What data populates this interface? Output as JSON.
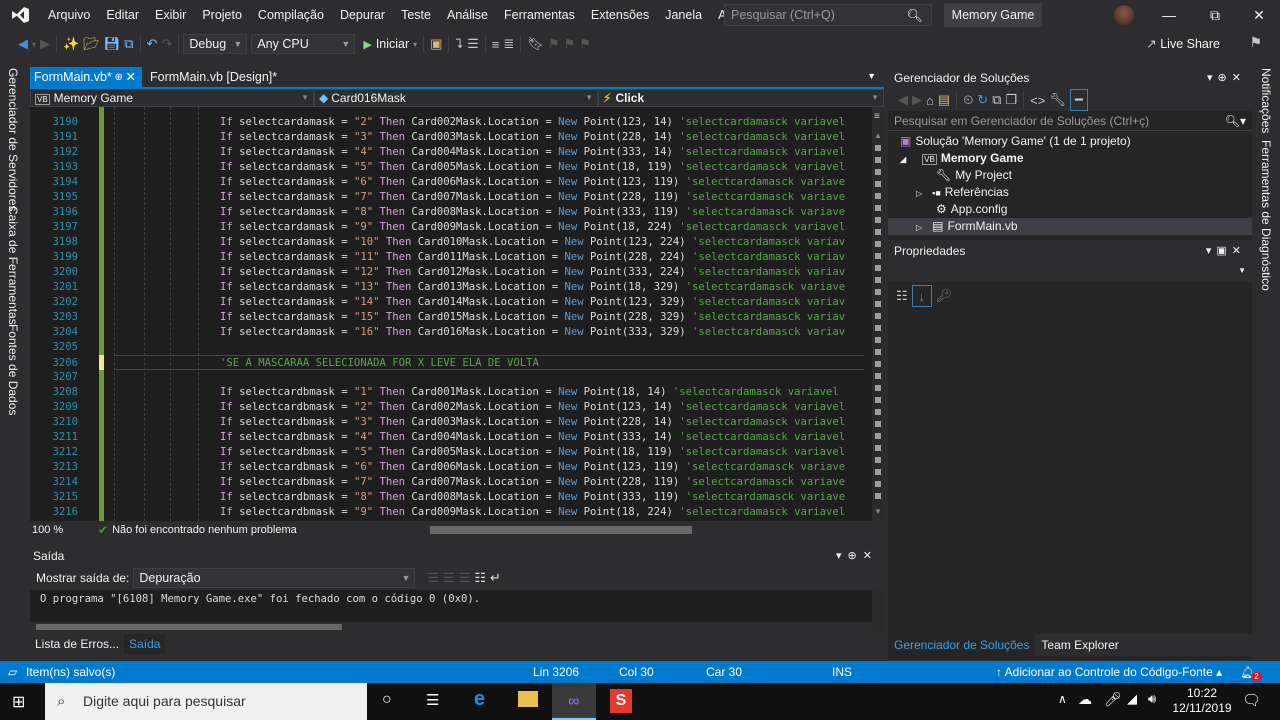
{
  "menubar": {
    "items": [
      "Arquivo",
      "Editar",
      "Exibir",
      "Projeto",
      "Compilação",
      "Depurar",
      "Teste",
      "Análise",
      "Ferramentas",
      "Extensões",
      "Janela",
      "Ajuda"
    ],
    "search_placeholder": "Pesquisar (Ctrl+Q)",
    "solution_name": "Memory Game"
  },
  "toolbar": {
    "config": "Debug",
    "platform": "Any CPU",
    "start_label": "Iniciar",
    "live_share": "Live Share"
  },
  "left_strip": [
    "Gerenciador de Servidores",
    "Caixa de Ferramentas",
    "Fontes de Dados"
  ],
  "editor": {
    "tabs": [
      {
        "label": "FormMain.vb*",
        "active": true
      },
      {
        "label": "FormMain.vb [Design]*",
        "active": false
      }
    ],
    "nav": {
      "project": "Memory Game",
      "object": "Card016Mask",
      "event": "Click"
    },
    "lines": [
      {
        "n": "3190",
        "var": "selectcardamask",
        "val": "\"2\"",
        "card": "Card002Mask",
        "pt": "Point(123, 14)",
        "cmt": "'selectcardamasck variavel"
      },
      {
        "n": "3191",
        "var": "selectcardamask",
        "val": "\"3\"",
        "card": "Card003Mask",
        "pt": "Point(228, 14)",
        "cmt": "'selectcardamasck variavel"
      },
      {
        "n": "3192",
        "var": "selectcardamask",
        "val": "\"4\"",
        "card": "Card004Mask",
        "pt": "Point(333, 14)",
        "cmt": "'selectcardamasck variavel"
      },
      {
        "n": "3193",
        "var": "selectcardamask",
        "val": "\"5\"",
        "card": "Card005Mask",
        "pt": "Point(18, 119)",
        "cmt": "'selectcardamasck variavel"
      },
      {
        "n": "3194",
        "var": "selectcardamask",
        "val": "\"6\"",
        "card": "Card006Mask",
        "pt": "Point(123, 119)",
        "cmt": "'selectcardamasck variave"
      },
      {
        "n": "3195",
        "var": "selectcardamask",
        "val": "\"7\"",
        "card": "Card007Mask",
        "pt": "Point(228, 119)",
        "cmt": "'selectcardamasck variave"
      },
      {
        "n": "3196",
        "var": "selectcardamask",
        "val": "\"8\"",
        "card": "Card008Mask",
        "pt": "Point(333, 119)",
        "cmt": "'selectcardamasck variave"
      },
      {
        "n": "3197",
        "var": "selectcardamask",
        "val": "\"9\"",
        "card": "Card009Mask",
        "pt": "Point(18, 224)",
        "cmt": "'selectcardamasck variavel"
      },
      {
        "n": "3198",
        "var": "selectcardamask",
        "val": "\"10\"",
        "card": "Card010Mask",
        "pt": "Point(123, 224)",
        "cmt": "'selectcardamasck variav"
      },
      {
        "n": "3199",
        "var": "selectcardamask",
        "val": "\"11\"",
        "card": "Card011Mask",
        "pt": "Point(228, 224)",
        "cmt": "'selectcardamasck variav"
      },
      {
        "n": "3200",
        "var": "selectcardamask",
        "val": "\"12\"",
        "card": "Card012Mask",
        "pt": "Point(333, 224)",
        "cmt": "'selectcardamasck variav"
      },
      {
        "n": "3201",
        "var": "selectcardamask",
        "val": "\"13\"",
        "card": "Card013Mask",
        "pt": "Point(18, 329)",
        "cmt": "'selectcardamasck variave"
      },
      {
        "n": "3202",
        "var": "selectcardamask",
        "val": "\"14\"",
        "card": "Card014Mask",
        "pt": "Point(123, 329)",
        "cmt": "'selectcardamasck variav"
      },
      {
        "n": "3203",
        "var": "selectcardamask",
        "val": "\"15\"",
        "card": "Card015Mask",
        "pt": "Point(228, 329)",
        "cmt": "'selectcardamasck variav"
      },
      {
        "n": "3204",
        "var": "selectcardamask",
        "val": "\"16\"",
        "card": "Card016Mask",
        "pt": "Point(333, 329)",
        "cmt": "'selectcardamasck variav"
      },
      {
        "n": "3205",
        "blank": true
      },
      {
        "n": "3206",
        "comment_only": "'SE A MASCARAA SELECIONADA FOR X LEVE ELA DE VOLTA"
      },
      {
        "n": "3207",
        "blank": true
      },
      {
        "n": "3208",
        "var": "selectcardbmask",
        "val": "\"1\"",
        "card": "Card001Mask",
        "pt": "Point(18, 14)",
        "cmt": "'selectcardamasck variavel"
      },
      {
        "n": "3209",
        "var": "selectcardbmask",
        "val": "\"2\"",
        "card": "Card002Mask",
        "pt": "Point(123, 14)",
        "cmt": "'selectcardamasck variavel"
      },
      {
        "n": "3210",
        "var": "selectcardbmask",
        "val": "\"3\"",
        "card": "Card003Mask",
        "pt": "Point(228, 14)",
        "cmt": "'selectcardamasck variavel"
      },
      {
        "n": "3211",
        "var": "selectcardbmask",
        "val": "\"4\"",
        "card": "Card004Mask",
        "pt": "Point(333, 14)",
        "cmt": "'selectcardamasck variavel"
      },
      {
        "n": "3212",
        "var": "selectcardbmask",
        "val": "\"5\"",
        "card": "Card005Mask",
        "pt": "Point(18, 119)",
        "cmt": "'selectcardamasck variavel"
      },
      {
        "n": "3213",
        "var": "selectcardbmask",
        "val": "\"6\"",
        "card": "Card006Mask",
        "pt": "Point(123, 119)",
        "cmt": "'selectcardamasck variave"
      },
      {
        "n": "3214",
        "var": "selectcardbmask",
        "val": "\"7\"",
        "card": "Card007Mask",
        "pt": "Point(228, 119)",
        "cmt": "'selectcardamasck variave"
      },
      {
        "n": "3215",
        "var": "selectcardbmask",
        "val": "\"8\"",
        "card": "Card008Mask",
        "pt": "Point(333, 119)",
        "cmt": "'selectcardamasck variave"
      },
      {
        "n": "3216",
        "var": "selectcardbmask",
        "val": "\"9\"",
        "card": "Card009Mask",
        "pt": "Point(18, 224)",
        "cmt": "'selectcardamasck variavel"
      }
    ],
    "keywords": {
      "if": "If",
      "then": "Then",
      "location": ".Location = ",
      "new": "New"
    },
    "zoom": "100 %",
    "issues": "Não foi encontrado nenhum problema"
  },
  "output": {
    "title": "Saída",
    "show_from_label": "Mostrar saída de:",
    "source": "Depuração",
    "text": "O programa \"[6108] Memory Game.exe\" foi fechado com o código 0 (0x0).",
    "bottom_tabs": [
      "Lista de Erros...",
      "Saída"
    ]
  },
  "solution_explorer": {
    "title": "Gerenciador de Soluções",
    "search_placeholder": "Pesquisar em Gerenciador de Soluções (Ctrl+ç)",
    "tree": [
      {
        "label": "Solução 'Memory Game' (1 de 1 projeto)",
        "level": 0
      },
      {
        "label": "Memory Game",
        "level": 1,
        "bold": true
      },
      {
        "label": "My Project",
        "level": 2
      },
      {
        "label": "Referências",
        "level": 2
      },
      {
        "label": "App.config",
        "level": 2
      },
      {
        "label": "FormMain.vb",
        "level": 2,
        "selected": true
      }
    ],
    "bottom_tabs": [
      "Gerenciador de Soluções",
      "Team Explorer"
    ]
  },
  "properties": {
    "title": "Propriedades"
  },
  "right_strip": [
    "Notificações",
    "Ferramentas de Diagnóstico"
  ],
  "statusbar": {
    "message": "Item(ns) salvo(s)",
    "line": "Lin 3206",
    "col": "Col 30",
    "char": "Car 30",
    "mode": "INS",
    "source_control": "Adicionar ao Controle do Código-Fonte",
    "notifications": "2"
  },
  "taskbar": {
    "search_placeholder": "Digite aqui para pesquisar",
    "time": "10:22",
    "date": "12/11/2019"
  },
  "colors": {
    "accent": "#007acc",
    "keyword": "#d8a0df",
    "string": "#d69d85",
    "comment": "#57a64a",
    "new": "#569cd6"
  }
}
